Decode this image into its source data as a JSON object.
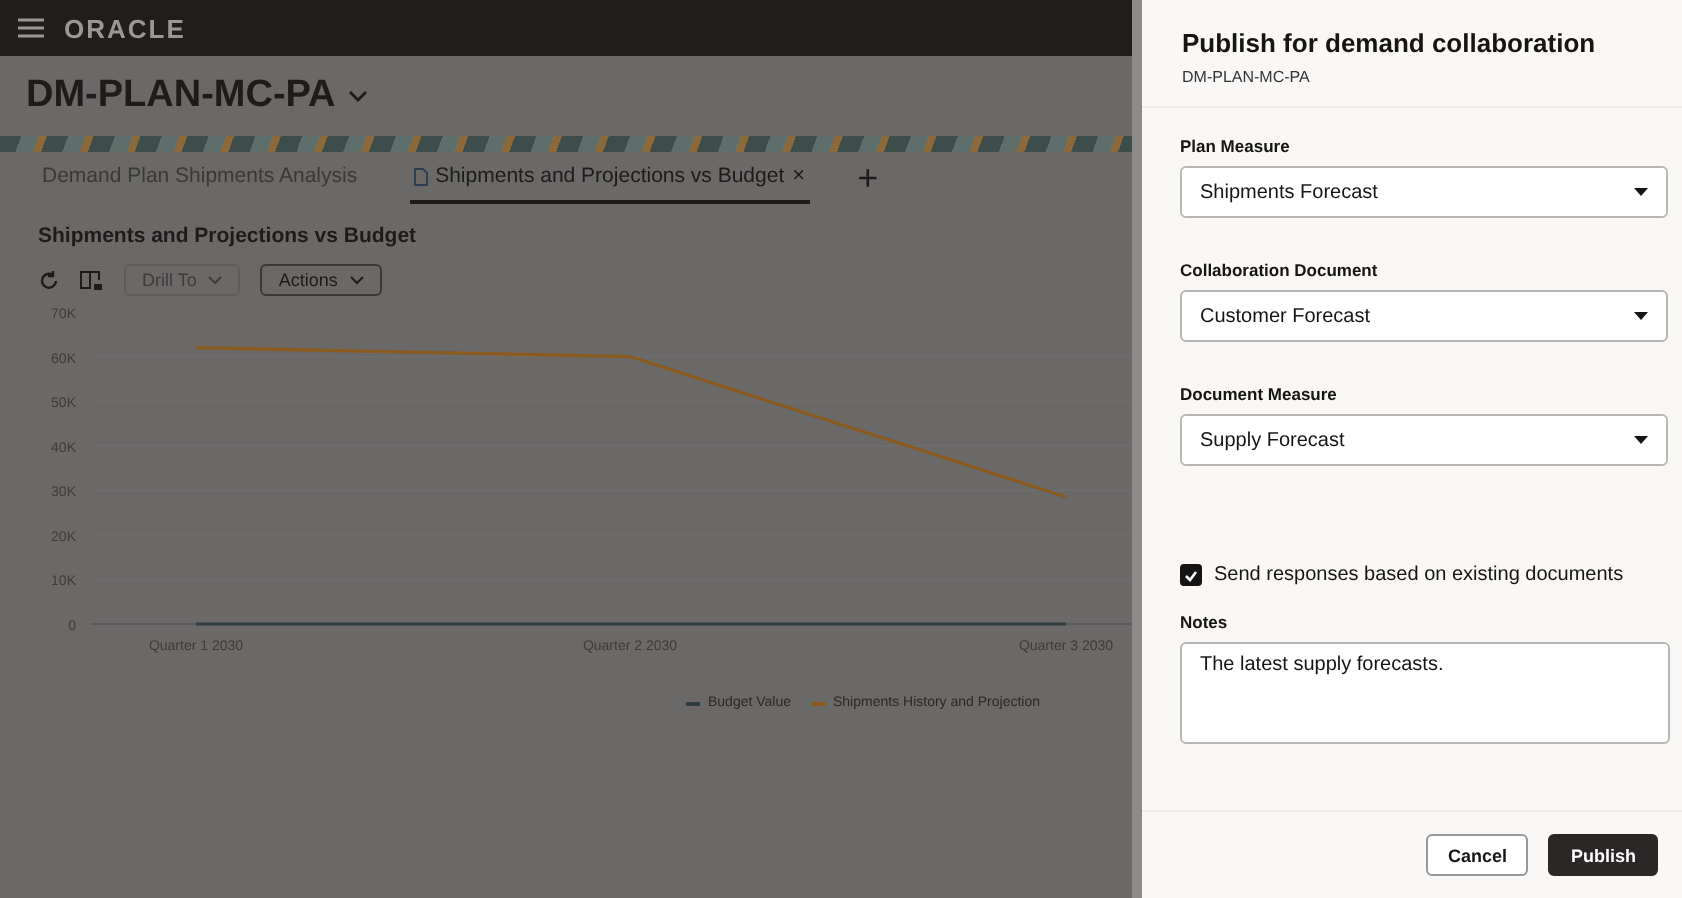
{
  "header": {
    "logo": "ORACLE"
  },
  "page": {
    "title": "DM-PLAN-MC-PA"
  },
  "tabs": [
    {
      "label": "Demand Plan Shipments Analysis",
      "selected": false
    },
    {
      "label": "Shipments and Projections vs Budget",
      "selected": true,
      "close": "×"
    }
  ],
  "add_tab": "+",
  "report": {
    "title": "Shipments and Projections vs Budget",
    "toolbar": [
      {
        "kind": "refresh"
      },
      {
        "kind": "view"
      },
      {
        "kind": "menu",
        "label": "Drill To",
        "disabled": true
      },
      {
        "kind": "menu",
        "label": "Actions",
        "disabled": false
      }
    ],
    "chart_data": {
      "type": "line",
      "categories": [
        "Quarter 1 2030",
        "Quarter 2 2030",
        "Quarter 3 2030"
      ],
      "ylim": [
        0,
        70000
      ],
      "yticks": [
        {
          "value": 0,
          "label": "0"
        },
        {
          "value": 10000,
          "label": "10K"
        },
        {
          "value": 20000,
          "label": "20K"
        },
        {
          "value": 30000,
          "label": "30K"
        },
        {
          "value": 40000,
          "label": "40K"
        },
        {
          "value": 50000,
          "label": "50K"
        },
        {
          "value": 60000,
          "label": "60K"
        },
        {
          "value": 70000,
          "label": "70K"
        }
      ],
      "series": [
        {
          "name": "Budget Value",
          "color": "#2f3d40",
          "values": [
            0,
            0,
            0
          ]
        },
        {
          "name": "Shipments History and Projection",
          "color": "#8a5a1e",
          "values": [
            62000,
            60000,
            28500
          ]
        }
      ]
    }
  },
  "drawer": {
    "title": "Publish for demand collaboration",
    "subtitle": "DM-PLAN-MC-PA",
    "fields": [
      {
        "label": "Plan Measure",
        "value": "Shipments Forecast"
      },
      {
        "label": "Collaboration Document",
        "value": "Customer Forecast"
      },
      {
        "label": "Document Measure",
        "value": "Supply Forecast"
      }
    ],
    "checkbox": {
      "label": "Send responses based on existing documents",
      "checked": true
    },
    "notes": {
      "label": "Notes",
      "value": "The latest supply forecasts."
    },
    "buttons": [
      {
        "label": "Cancel",
        "kind": "secondary"
      },
      {
        "label": "Publish",
        "kind": "primary"
      }
    ]
  }
}
